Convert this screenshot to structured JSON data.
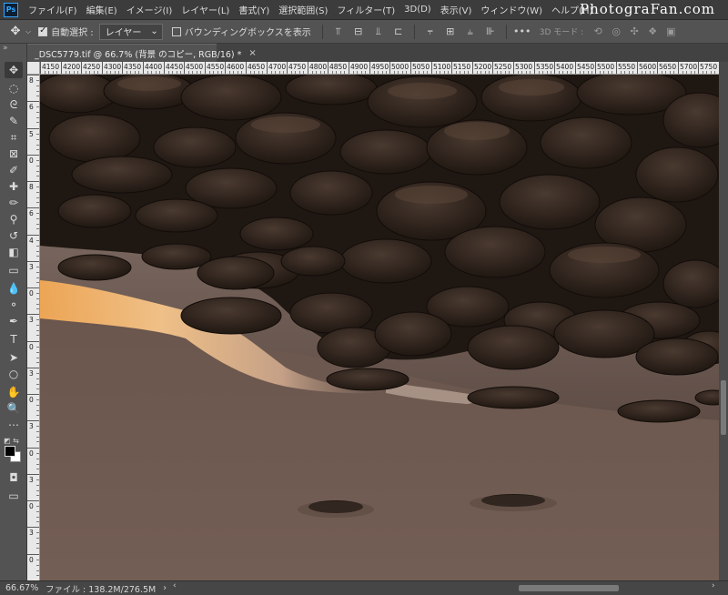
{
  "app": {
    "logo": "Ps",
    "brand": "PhotograFan.com"
  },
  "menu": [
    "ファイル(F)",
    "編集(E)",
    "イメージ(I)",
    "レイヤー(L)",
    "書式(Y)",
    "選択範囲(S)",
    "フィルター(T)",
    "3D(D)",
    "表示(V)",
    "ウィンドウ(W)",
    "ヘルプ(H)"
  ],
  "options": {
    "auto_select_label": "自動選択 :",
    "auto_select_checked": true,
    "target_value": "レイヤー",
    "transform_controls_label": "バウンディングボックスを表示",
    "transform_controls_checked": false,
    "more_label": "•••",
    "mode3d_label": "3D モード :"
  },
  "document": {
    "tab_title": "_DSC5779.tif @ 66.7% (背景 のコピー, RGB/16) *",
    "close_glyph": "×"
  },
  "ruler": {
    "top_labels": [
      "4150",
      "4200",
      "4250",
      "4300",
      "4350",
      "4400",
      "4450",
      "4500",
      "4550",
      "4600",
      "4650",
      "4700",
      "4750",
      "4800",
      "4850",
      "4900",
      "4950",
      "5000",
      "5050",
      "5100",
      "5150",
      "5200",
      "5250",
      "5300",
      "5350",
      "5400",
      "5450",
      "5500",
      "5550",
      "5600",
      "5650",
      "5700",
      "5750"
    ],
    "left_labels": [
      "8",
      "6",
      "5",
      "0",
      "8",
      "6",
      "4",
      "3",
      "0",
      "3",
      "0",
      "3",
      "0",
      "3",
      "0",
      "3",
      "0",
      "3",
      "0"
    ]
  },
  "status": {
    "zoom": "66.67%",
    "file_info": "ファイル : 138.2M/276.5M",
    "arrow": "›"
  },
  "colors": {
    "chrome": "#535353",
    "menubar": "#3c3c3c",
    "ps_accent": "#31a8ff",
    "sand": "#6d5a52",
    "glow": "#f0b46a"
  }
}
